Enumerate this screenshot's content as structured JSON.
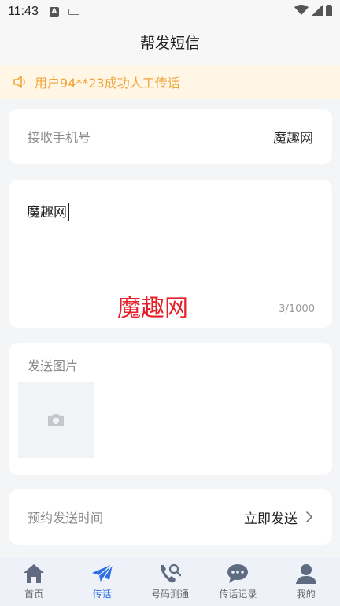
{
  "status_bar": {
    "time": "11:43"
  },
  "header": {
    "title": "帮发短信"
  },
  "notice": {
    "text": "用户94**23成功人工传话"
  },
  "recipient": {
    "label": "接收手机号",
    "value": "魔趣网"
  },
  "message": {
    "text": "魔趣网",
    "counter": "3/1000",
    "watermark": "魔趣网"
  },
  "photo": {
    "label": "发送图片"
  },
  "schedule": {
    "label": "预约发送时间",
    "value": "立即发送"
  },
  "tabs": [
    {
      "label": "首页",
      "icon": "home-icon"
    },
    {
      "label": "传话",
      "icon": "paper-plane-icon"
    },
    {
      "label": "号码测通",
      "icon": "phone-search-icon"
    },
    {
      "label": "传话记录",
      "icon": "chat-bubble-icon"
    },
    {
      "label": "我的",
      "icon": "user-icon"
    }
  ],
  "colors": {
    "accent": "#2f6fe3",
    "notice": "#f0a53a",
    "watermark": "#e8202a"
  }
}
